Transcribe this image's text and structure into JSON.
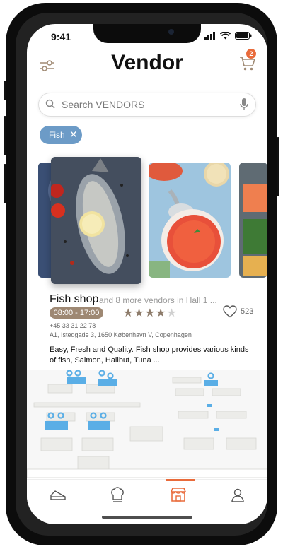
{
  "status_bar": {
    "time": "9:41"
  },
  "header": {
    "title": "Vendor",
    "cart_count": "2"
  },
  "search": {
    "placeholder": "Search VENDORS"
  },
  "filters": [
    {
      "label": "Fish"
    }
  ],
  "vendor": {
    "name": "Fish shop",
    "more": "and 8 more vendors in Hall 1 ...",
    "hours": "08:00 - 17:00",
    "rating": 4,
    "rating_max": 5,
    "likes": "523",
    "phone": "+45 33 31 22 78",
    "address": "A1, Istedgade 3, 1650 København V, Copenhagen",
    "description": "Easy, Fresh and Quality. Fish shop provides various kinds of fish, Salmon, Halibut, Tuna ..."
  },
  "nav": {
    "active": "vendors"
  },
  "colors": {
    "accent": "#e96b3b",
    "chip": "#6c9bc7",
    "hours_badge": "#9e8873",
    "map_highlight": "#5aaee6"
  }
}
